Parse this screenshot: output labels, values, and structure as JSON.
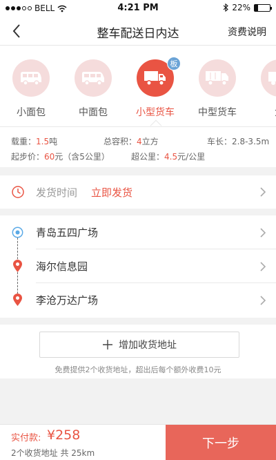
{
  "status_bar": {
    "carrier": "BELL",
    "time": "4:21 PM",
    "battery_percent": "22%",
    "battery_level": 0.22,
    "icons": [
      "signal-dots",
      "wifi-icon",
      "bluetooth-icon",
      "battery-icon"
    ]
  },
  "nav": {
    "title": "整车配送日内达",
    "right_link": "资费说明",
    "back_icon": "back-arrow-icon"
  },
  "vehicles": {
    "items": [
      {
        "label": "小面包",
        "icon": "minivan-icon",
        "active": false
      },
      {
        "label": "中面包",
        "icon": "van-icon",
        "active": false
      },
      {
        "label": "小型货车",
        "icon": "small-truck-icon",
        "active": true,
        "badge": "板"
      },
      {
        "label": "中型货车",
        "icon": "medium-truck-icon",
        "active": false
      },
      {
        "label": "大",
        "icon": "large-truck-icon",
        "active": false
      }
    ]
  },
  "specs": {
    "load_label": "载重：",
    "load_value": "1.5",
    "load_unit": "吨",
    "volume_label": "总容积：",
    "volume_value": "4",
    "volume_unit": "立方",
    "length_label": "车长：",
    "length_value": "2.8-3.5m",
    "start_label": "起步价：",
    "start_value": "60",
    "start_unit": "元（含5公里）",
    "over_label": "超公里：",
    "over_value": "4.5",
    "over_unit": "元/公里"
  },
  "shipping": {
    "label": "发货时间",
    "value": "立即发货"
  },
  "addresses": [
    {
      "text": "青岛五四广场",
      "type": "origin"
    },
    {
      "text": "海尔信息园",
      "type": "destination"
    },
    {
      "text": "李沧万达广场",
      "type": "destination"
    }
  ],
  "add_address": {
    "label": "增加收货地址",
    "note": "免费提供2个收货地址，超出后每个额外收费10元"
  },
  "bottom": {
    "pay_label": "实付款:",
    "pay_amount": "¥258",
    "summary": "2个收货地址 共 25km",
    "next_button": "下一步"
  },
  "colors": {
    "accent": "#e95443",
    "button": "#e8665a",
    "badge": "#6aa3d6",
    "origin_marker": "#5aa9e6"
  }
}
